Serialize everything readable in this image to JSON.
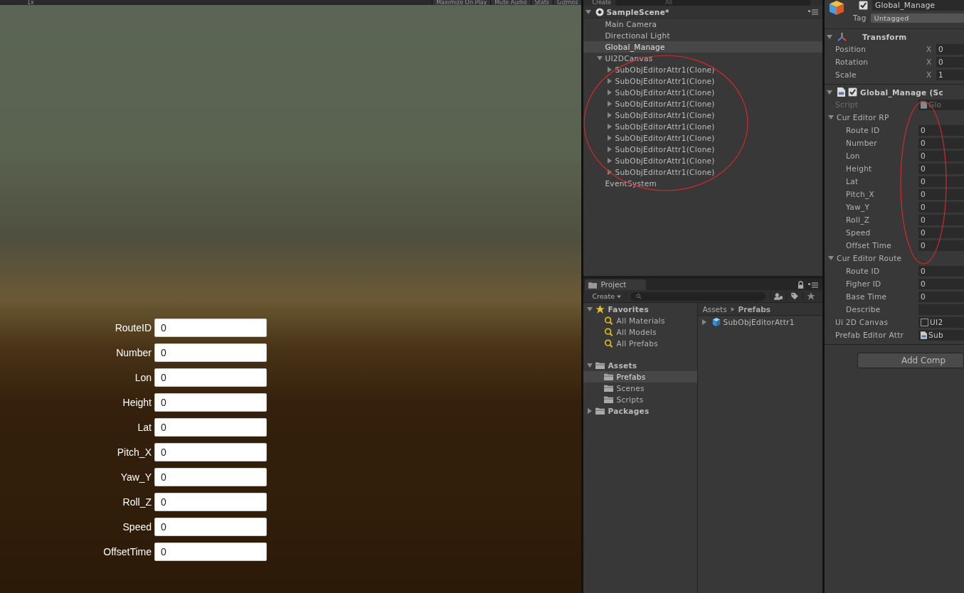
{
  "game_view": {
    "toolbar": {
      "scale": "1x",
      "buttons": [
        "Maximize On Play",
        "Mute Audio",
        "Stats",
        "Gizmos"
      ]
    },
    "form": [
      {
        "label": "RouteID",
        "value": "0"
      },
      {
        "label": "Number",
        "value": "0"
      },
      {
        "label": "Lon",
        "value": "0"
      },
      {
        "label": "Height",
        "value": "0"
      },
      {
        "label": "Lat",
        "value": "0"
      },
      {
        "label": "Pitch_X",
        "value": "0"
      },
      {
        "label": "Yaw_Y",
        "value": "0"
      },
      {
        "label": "Roll_Z",
        "value": "0"
      },
      {
        "label": "Speed",
        "value": "0"
      },
      {
        "label": "OffsetTime",
        "value": "0"
      }
    ]
  },
  "hierarchy": {
    "toolbar": {
      "create": "Create",
      "search": "All"
    },
    "scene": "SampleScene*",
    "items": [
      {
        "label": "Main Camera",
        "selected": false
      },
      {
        "label": "Directional Light",
        "selected": false
      },
      {
        "label": "Global_Manage",
        "selected": true
      },
      {
        "label": "UI2DCanvas",
        "selected": false,
        "expanded": true,
        "children": [
          {
            "label": "SubObjEditorAttr1(Clone)",
            "selected": false,
            "expanded": false
          },
          {
            "label": "SubObjEditorAttr1(Clone)",
            "selected": false,
            "expanded": false
          },
          {
            "label": "SubObjEditorAttr1(Clone)",
            "selected": false,
            "expanded": false
          },
          {
            "label": "SubObjEditorAttr1(Clone)",
            "selected": false,
            "expanded": false
          },
          {
            "label": "SubObjEditorAttr1(Clone)",
            "selected": false,
            "expanded": false
          },
          {
            "label": "SubObjEditorAttr1(Clone)",
            "selected": false,
            "expanded": false
          },
          {
            "label": "SubObjEditorAttr1(Clone)",
            "selected": false,
            "expanded": false
          },
          {
            "label": "SubObjEditorAttr1(Clone)",
            "selected": false,
            "expanded": false
          },
          {
            "label": "SubObjEditorAttr1(Clone)",
            "selected": false,
            "expanded": false
          },
          {
            "label": "SubObjEditorAttr1(Clone)",
            "selected": false,
            "expanded": false
          }
        ]
      },
      {
        "label": "EventSystem",
        "selected": false
      }
    ]
  },
  "project": {
    "tab": "Project",
    "create": "Create",
    "tree": [
      {
        "label": "Favorites",
        "kind": "favorites",
        "selected": false,
        "expanded": true,
        "children": [
          {
            "label": "All Materials",
            "kind": "search",
            "selected": false
          },
          {
            "label": "All Models",
            "kind": "search",
            "selected": false
          },
          {
            "label": "All Prefabs",
            "kind": "search",
            "selected": false
          }
        ]
      },
      {
        "label": "Assets",
        "kind": "folder",
        "selected": false,
        "expanded": true,
        "children": [
          {
            "label": "Prefabs",
            "kind": "folder",
            "selected": true
          },
          {
            "label": "Scenes",
            "kind": "folder",
            "selected": false
          },
          {
            "label": "Scripts",
            "kind": "folder",
            "selected": false
          }
        ]
      },
      {
        "label": "Packages",
        "kind": "folder",
        "selected": false,
        "expanded": false
      }
    ],
    "breadcrumb": [
      "Assets",
      "Prefabs"
    ],
    "assets": [
      {
        "label": "SubObjEditorAttr1",
        "expanded": false
      }
    ]
  },
  "inspector": {
    "object": {
      "name": "Global_Manage",
      "active": true,
      "tag_label": "Tag",
      "tag": "Untagged"
    },
    "transform": {
      "title": "Transform",
      "expanded": true,
      "rows": [
        {
          "label": "Position",
          "axis": "X",
          "value": "0"
        },
        {
          "label": "Rotation",
          "axis": "X",
          "value": "0"
        },
        {
          "label": "Scale",
          "axis": "X",
          "value": "1"
        }
      ]
    },
    "component": {
      "title": "Global_Manage (Sc",
      "enabled": true,
      "expanded": true,
      "script_label": "Script",
      "script_value": "Glo"
    },
    "groups": [
      {
        "label": "Cur Editor RP",
        "expanded": true,
        "fields": [
          {
            "label": "Route ID",
            "value": "0"
          },
          {
            "label": "Number",
            "value": "0"
          },
          {
            "label": "Lon",
            "value": "0"
          },
          {
            "label": "Height",
            "value": "0"
          },
          {
            "label": "Lat",
            "value": "0"
          },
          {
            "label": "Pitch_X",
            "value": "0"
          },
          {
            "label": "Yaw_Y",
            "value": "0"
          },
          {
            "label": "Roll_Z",
            "value": "0"
          },
          {
            "label": "Speed",
            "value": "0"
          },
          {
            "label": "Offset Time",
            "value": "0"
          }
        ]
      },
      {
        "label": "Cur Editor Route",
        "expanded": true,
        "fields": [
          {
            "label": "Route ID",
            "value": "0"
          },
          {
            "label": "Figher ID",
            "value": "0"
          },
          {
            "label": "Base Time",
            "value": "0"
          },
          {
            "label": "Describe"
          }
        ]
      }
    ],
    "refs": [
      {
        "label": "Ui 2D Canvas",
        "value": "UI2",
        "kind": "object"
      },
      {
        "label": "Prefab Editor Attr",
        "value": "Sub",
        "kind": "script"
      }
    ],
    "add_button": "Add Comp"
  }
}
